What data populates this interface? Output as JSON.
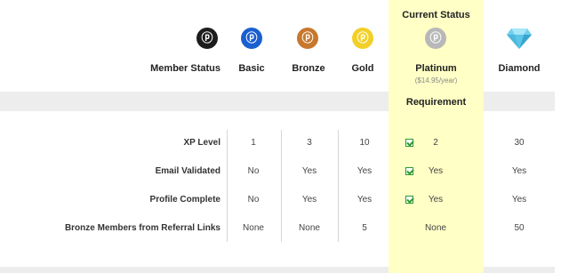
{
  "header": {
    "current_status": "Current Status",
    "requirement": "Requirement",
    "member_status": "Member Status",
    "platinum_price": "($14.95/year)"
  },
  "tiers": [
    {
      "name": "Basic",
      "color": "#1a5fd1",
      "icon": "basic-badge-icon"
    },
    {
      "name": "Bronze",
      "color": "#c8782e",
      "icon": "bronze-badge-icon"
    },
    {
      "name": "Gold",
      "color": "#f2d02a",
      "icon": "gold-badge-icon"
    },
    {
      "name": "Platinum",
      "color": "#b8b8b8",
      "icon": "platinum-badge-icon"
    },
    {
      "name": "Diamond",
      "color": "#5cc6e8",
      "icon": "diamond-icon"
    }
  ],
  "member_badge": {
    "color": "#1c1c1c",
    "icon": "member-badge-icon"
  },
  "rows": [
    {
      "label": "XP Level",
      "values": [
        "1",
        "3",
        "10",
        "2",
        "30"
      ],
      "platinum_check": true
    },
    {
      "label": "Email Validated",
      "values": [
        "No",
        "Yes",
        "Yes",
        "Yes",
        "Yes"
      ],
      "platinum_check": true
    },
    {
      "label": "Profile Complete",
      "values": [
        "No",
        "Yes",
        "Yes",
        "Yes",
        "Yes"
      ],
      "platinum_check": true
    },
    {
      "label": "Bronze Members from Referral Links",
      "values": [
        "None",
        "None",
        "5",
        "None",
        "50"
      ],
      "platinum_check": false
    }
  ]
}
